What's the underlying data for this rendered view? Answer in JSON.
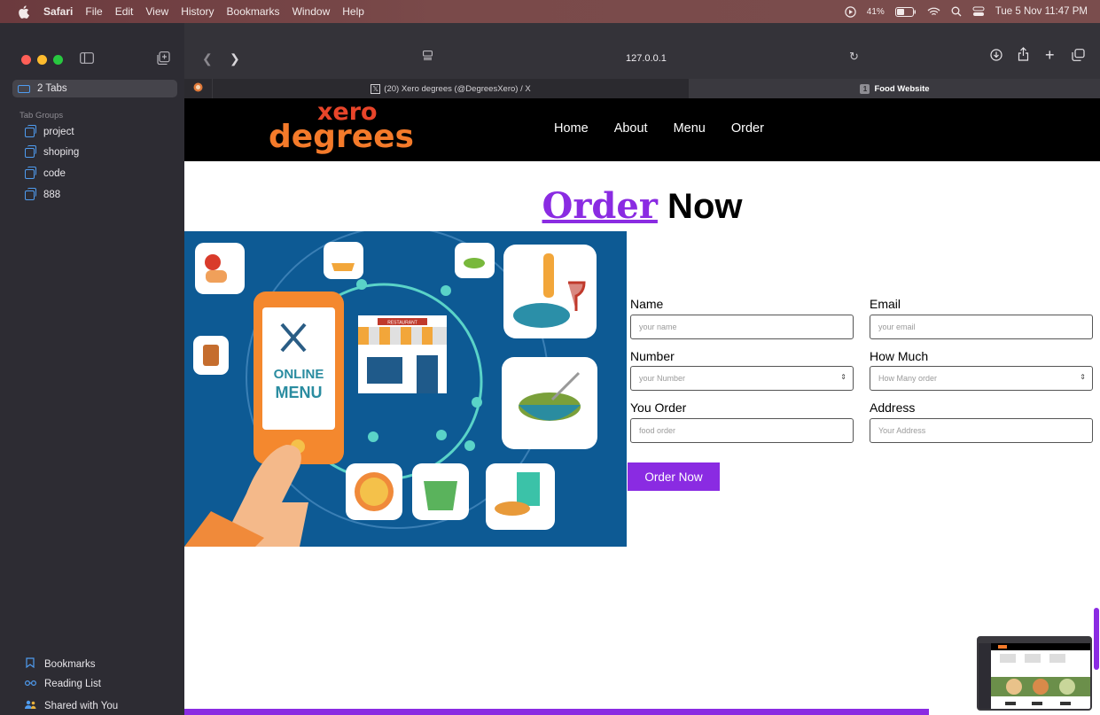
{
  "menubar": {
    "app": "Safari",
    "items": [
      "File",
      "Edit",
      "View",
      "History",
      "Bookmarks",
      "Window",
      "Help"
    ],
    "battery": "41%",
    "datetime": "Tue 5 Nov  11:47 PM"
  },
  "sidebar": {
    "tabs_label": "2 Tabs",
    "tab_groups_title": "Tab Groups",
    "groups": [
      "project",
      "shoping",
      "code",
      "888"
    ],
    "bottom": [
      "Bookmarks",
      "Reading List",
      "Shared with You"
    ]
  },
  "toolbar": {
    "url": "127.0.0.1"
  },
  "tabs": {
    "tab2_title": "(20) Xero degrees (@DegreesXero) / X",
    "tab3_badge": "1",
    "tab3_title": "Food Website"
  },
  "site": {
    "logo_top": "xero",
    "logo_bottom": "degrees",
    "nav": [
      "Home",
      "About",
      "Menu",
      "Order"
    ],
    "title_accent": "Order",
    "title_rest": " Now",
    "hero_text_1": "ONLINE",
    "hero_text_2": "MENU",
    "hero_sign": "RESTAURANT",
    "form": {
      "name_label": "Name",
      "name_placeholder": "your name",
      "email_label": "Email",
      "email_placeholder": "your email",
      "number_label": "Number",
      "number_placeholder": "your Number",
      "howmuch_label": "How Much",
      "howmuch_placeholder": "How Many order",
      "order_label": "You Order",
      "order_placeholder": "food order",
      "address_label": "Address",
      "address_placeholder": "Your Address",
      "submit": "Order Now"
    }
  },
  "colors": {
    "accent": "#8a2be2",
    "logo_top": "#e8452a",
    "logo_bottom": "#f47a2a",
    "hero_bg": "#0d5a94"
  }
}
